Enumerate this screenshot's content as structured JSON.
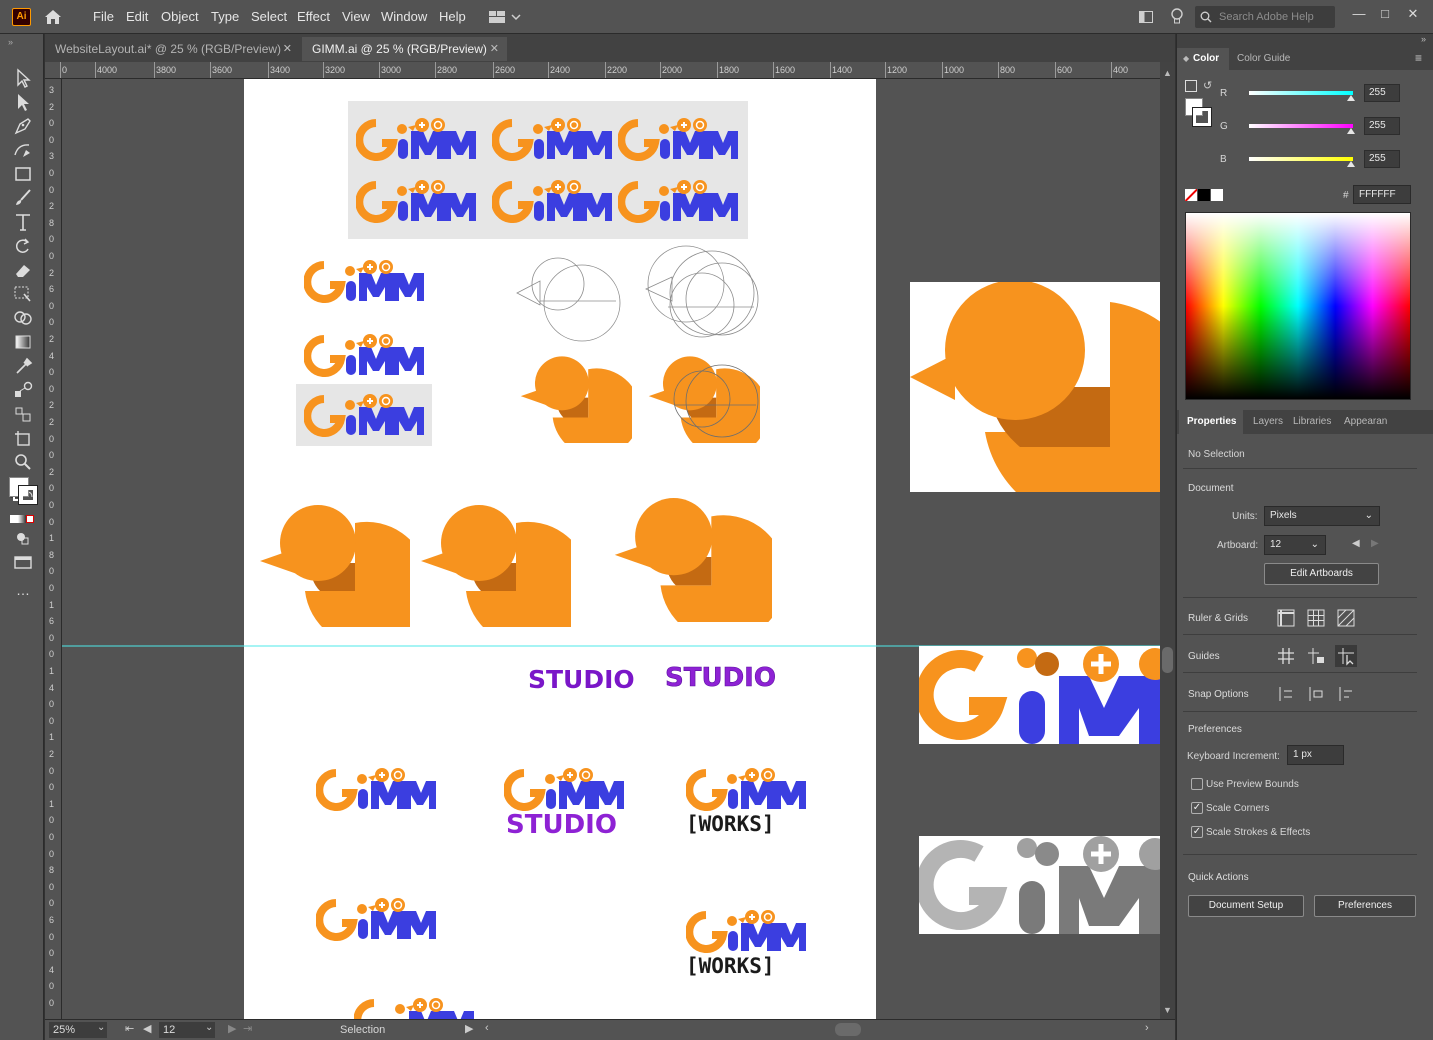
{
  "app": {
    "logo": "Ai",
    "search_placeholder": "Search Adobe Help"
  },
  "menu": [
    "File",
    "Edit",
    "Object",
    "Type",
    "Select",
    "Effect",
    "View",
    "Window",
    "Help"
  ],
  "tabs": [
    {
      "label": "WebsiteLayout.ai* @ 25 % (RGB/Preview)",
      "active": false
    },
    {
      "label": "GIMM.ai @ 25 % (RGB/Preview)",
      "active": true
    }
  ],
  "ruler_h": [
    "0",
    "4000",
    "3800",
    "3600",
    "3400",
    "3200",
    "3000",
    "2800",
    "2600",
    "2400",
    "2200",
    "2000",
    "1800",
    "1600",
    "1400",
    "1200",
    "1000",
    "800",
    "600",
    "400"
  ],
  "ruler_v": [
    "3",
    "2",
    "0",
    "0",
    "3",
    "0",
    "0",
    "2",
    "8",
    "0",
    "0",
    "2",
    "6",
    "0",
    "0",
    "2",
    "4",
    "0",
    "0",
    "2",
    "2",
    "0",
    "0",
    "2",
    "0",
    "0",
    "0",
    "1",
    "8",
    "0",
    "0",
    "1",
    "6",
    "0",
    "0",
    "1",
    "4",
    "0",
    "0",
    "1",
    "2",
    "0",
    "0",
    "1",
    "0",
    "0",
    "0",
    "8",
    "0",
    "0",
    "6",
    "0",
    "0",
    "4",
    "0",
    "0"
  ],
  "canvas_text": {
    "studio1": "STUDIO",
    "studio2": "STUDIO",
    "logo_studio": "STUDIO",
    "works1": "[WORKS]",
    "works2": "[WORKS]"
  },
  "status": {
    "zoom": "25%",
    "artboard": "12",
    "tool": "Selection"
  },
  "color_panel": {
    "tabs": [
      "Color",
      "Color Guide"
    ],
    "channels": [
      {
        "label": "R",
        "value": "255",
        "color": "#00ffff"
      },
      {
        "label": "G",
        "value": "255",
        "color": "#ff00ff"
      },
      {
        "label": "B",
        "value": "255",
        "color": "#ffff00"
      }
    ],
    "hex_label": "#",
    "hex": "FFFFFF"
  },
  "properties": {
    "tabs": [
      "Properties",
      "Layers",
      "Libraries",
      "Appearan"
    ],
    "selection": "No Selection",
    "document_title": "Document",
    "units_label": "Units:",
    "units_value": "Pixels",
    "artboard_label": "Artboard:",
    "artboard_value": "12",
    "edit_artboards": "Edit Artboards",
    "ruler_grids": "Ruler & Grids",
    "guides": "Guides",
    "snap_options": "Snap Options",
    "preferences_title": "Preferences",
    "keyboard_label": "Keyboard Increment:",
    "keyboard_value": "1 px",
    "use_preview_bounds": "Use Preview Bounds",
    "scale_corners": "Scale Corners",
    "scale_strokes": "Scale Strokes & Effects",
    "quick_actions": "Quick Actions",
    "document_setup": "Document Setup",
    "preferences_btn": "Preferences"
  },
  "colors": {
    "orange": "#f7931e",
    "shadow": "#c46a12",
    "blue": "#3b3ee0",
    "purple": "#7a16c8",
    "accent_cyan": "#00ffff"
  }
}
